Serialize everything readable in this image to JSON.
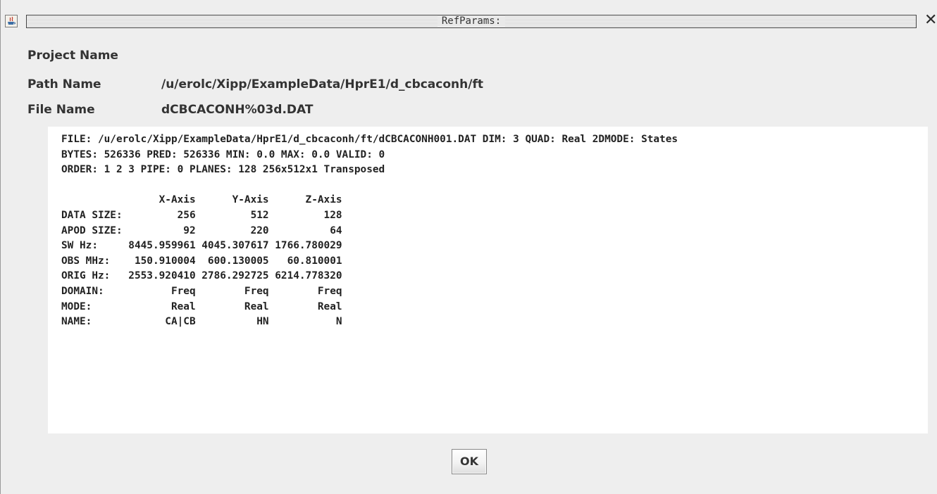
{
  "window": {
    "title": "RefParams:",
    "app_icon": "java-icon",
    "close_icon": "close-icon",
    "close_glyph": "✕"
  },
  "fields": {
    "project_name_label": "Project Name",
    "project_name_value": "",
    "path_name_label": "Path Name",
    "path_name_value": "/u/erolc/Xipp/ExampleData/HprE1/d_cbcaconh/ft",
    "file_name_label": "File Name",
    "file_name_value": "dCBCACONH%03d.DAT"
  },
  "info": {
    "text": "FILE: /u/erolc/Xipp/ExampleData/HprE1/d_cbcaconh/ft/dCBCACONH001.DAT DIM: 3 QUAD: Real 2DMODE: States\nBYTES: 526336 PRED: 526336 MIN: 0.0 MAX: 0.0 VALID: 0\nORDER: 1 2 3 PIPE: 0 PLANES: 128 256x512x1 Transposed\n\n                X-Axis      Y-Axis      Z-Axis\nDATA SIZE:         256         512         128\nAPOD SIZE:          92         220          64\nSW Hz:     8445.959961 4045.307617 1766.780029\nOBS MHz:    150.910004  600.130005   60.810001\nORIG Hz:   2553.920410 2786.292725 6214.778320\nDOMAIN:           Freq        Freq        Freq\nMODE:             Real        Real        Real\nNAME:            CA|CB          HN           N"
  },
  "buttons": {
    "ok_label": "OK"
  }
}
